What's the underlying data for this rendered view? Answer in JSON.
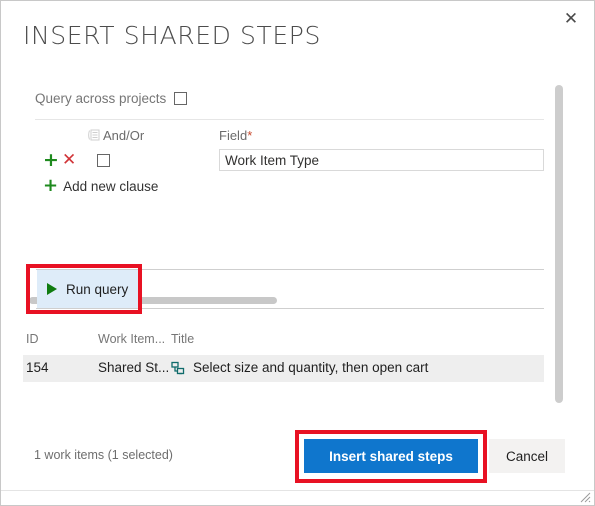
{
  "dialog": {
    "title": "INSERT SHARED STEPS",
    "close_icon": "close-icon",
    "close_glyph": "✕"
  },
  "query": {
    "across_projects_label": "Query across projects",
    "across_projects_checked": false,
    "columns": {
      "group_icon": "group-clauses-icon",
      "andor": "And/Or",
      "field": "Field",
      "field_required_marker": "*"
    },
    "clause": {
      "add_row_icon": "plus-icon",
      "add_row_glyph": "+",
      "delete_row_icon": "delete-icon",
      "delete_row_glyph": "✕",
      "group_checked": false,
      "andor_value": "",
      "field_value": "Work Item Type",
      "field_placeholder": "Field"
    },
    "add_new_clause": {
      "icon": "plus-icon",
      "glyph": "+",
      "label": "Add new clause"
    },
    "hscrollbar": "horizontal-scrollbar"
  },
  "toolbar": {
    "run_query_label": "Run query",
    "run_query_icon": "play-icon",
    "run_query_bg": "#deecf9",
    "play_color": "#107c10",
    "highlight_color": "#e81123"
  },
  "results": {
    "headers": [
      "ID",
      "Work Item...",
      "Title"
    ],
    "rows": [
      {
        "id": "154",
        "work_item_type": "Shared St...",
        "type_icon": "shared-steps-icon",
        "title": "Select size and quantity, then open cart",
        "selected": true
      }
    ],
    "vscrollbar": "vertical-scrollbar"
  },
  "footer": {
    "count_text": "1 work items (1 selected)",
    "primary_label": "Insert shared steps",
    "primary_color": "#0f76cd",
    "secondary_label": "Cancel",
    "resize_icon": "resize-grip-icon"
  }
}
